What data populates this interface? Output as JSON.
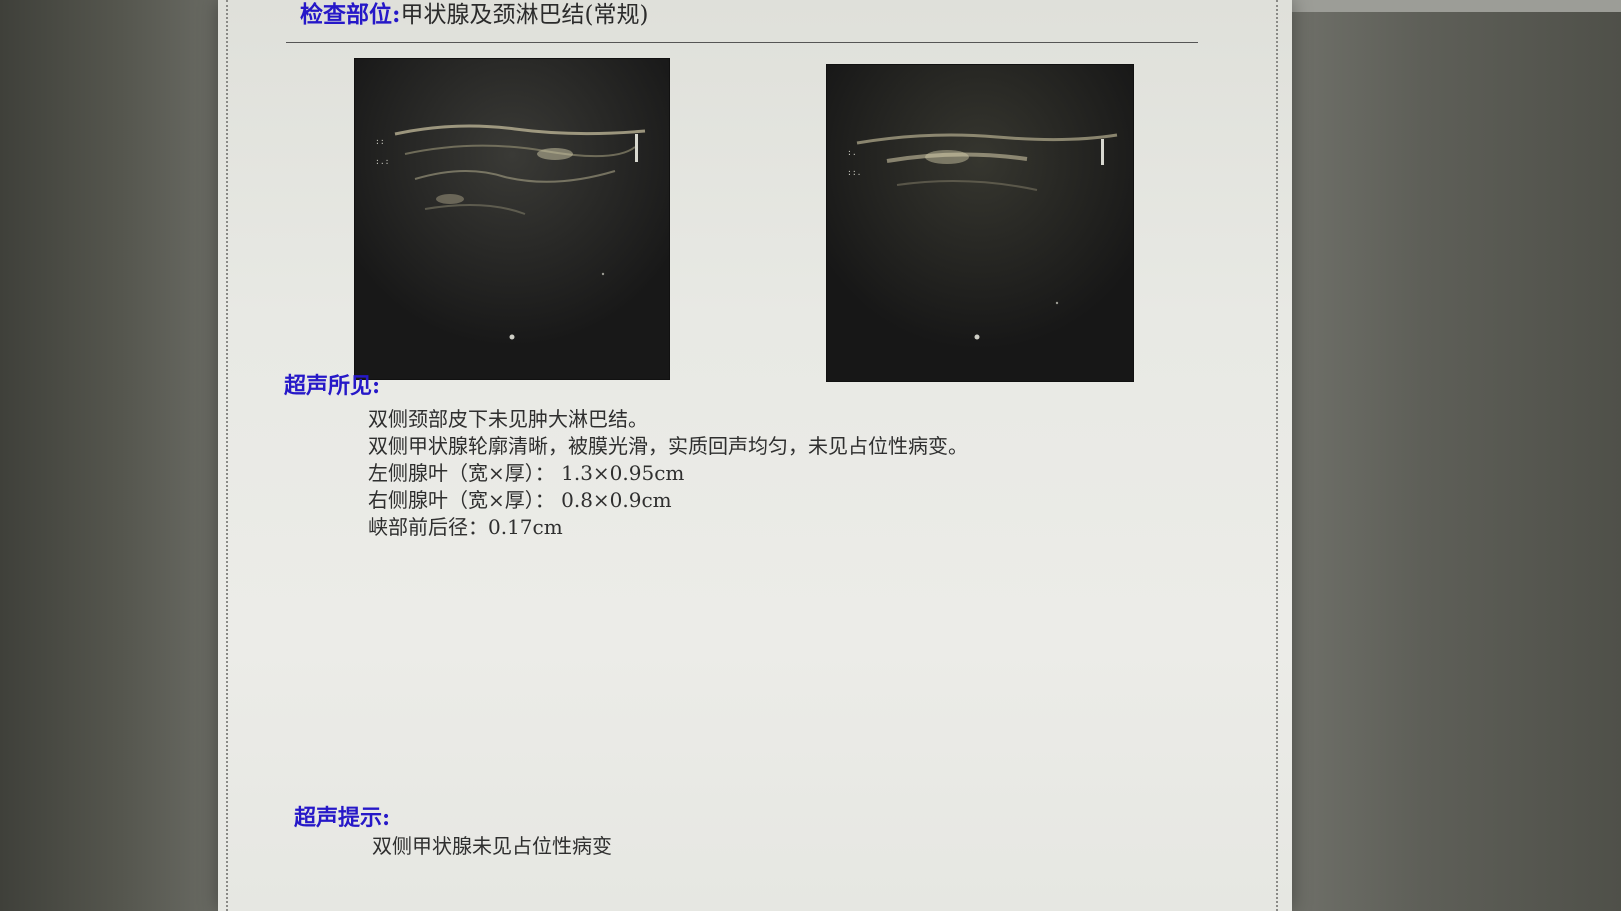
{
  "report": {
    "exam_site_label": "检查部位:",
    "exam_site_value": "甲状腺及颈淋巴结(常规)",
    "findings_label": "超声所见:",
    "findings": [
      "双侧颈部皮下未见肿大淋巴结。",
      "双侧甲状腺轮廓清晰，被膜光滑，实质回声均匀，未见占位性病变。",
      "左侧腺叶（宽×厚）： 1.3×0.95cm",
      "右侧腺叶（宽×厚）： 0.8×0.9cm",
      "峡部前后径：0.17cm"
    ],
    "impression_label": "超声提示:",
    "impression": "双侧甲状腺未见占位性病变"
  },
  "colors": {
    "label_blue": "#2618c8",
    "body_text": "#2f2f2f",
    "ultrasound_bg": "#1a1a1a"
  }
}
